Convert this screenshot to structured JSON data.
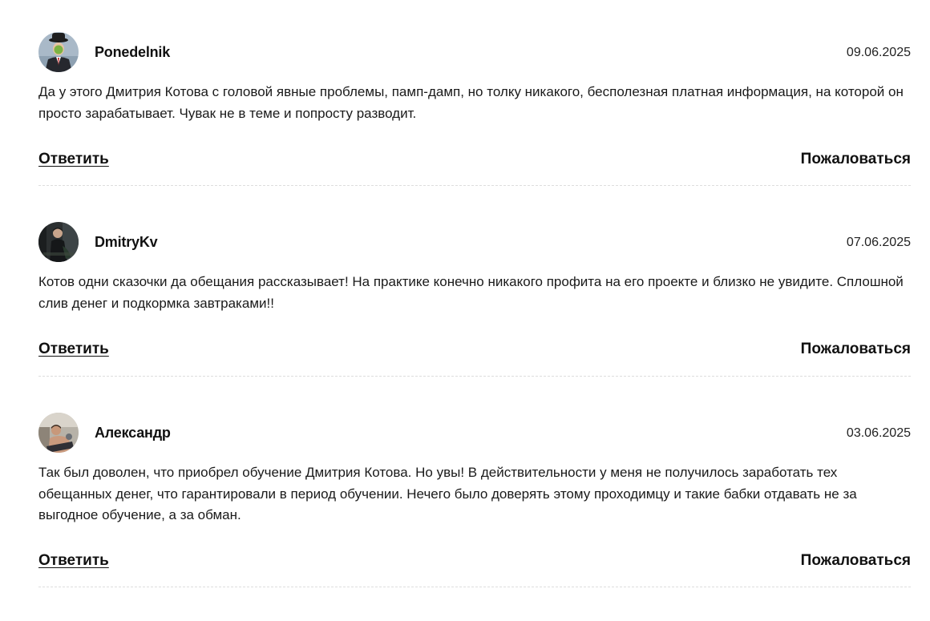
{
  "comments": [
    {
      "author": "Ponedelnik",
      "date": "09.06.2025",
      "text": "Да у этого Дмитрия Котова с головой явные проблемы, памп-дамп, но толку никакого, бесполезная платная информация, на которой он просто зарабатывает. Чувак не в теме и попросту разводит.",
      "reply_label": "Ответить",
      "report_label": "Пожаловаться"
    },
    {
      "author": "DmitryKv",
      "date": "07.06.2025",
      "text": "Котов одни сказочки да обещания рассказывает! На практике конечно никакого профита на его проекте и близко не увидите. Сплошной слив денег и подкормка завтраками!!",
      "reply_label": "Ответить",
      "report_label": "Пожаловаться"
    },
    {
      "author": "Александр",
      "date": "03.06.2025",
      "text": "Так был доволен, что приобрел обучение Дмитрия Котова. Но увы! В действительности у меня не получилось заработать тех обещанных денег, что гарантировали в период обучении. Нечего было доверять этому проходимцу и такие бабки отдавать не за выгодное обучение, а за обман.",
      "reply_label": "Ответить",
      "report_label": "Пожаловаться"
    }
  ]
}
